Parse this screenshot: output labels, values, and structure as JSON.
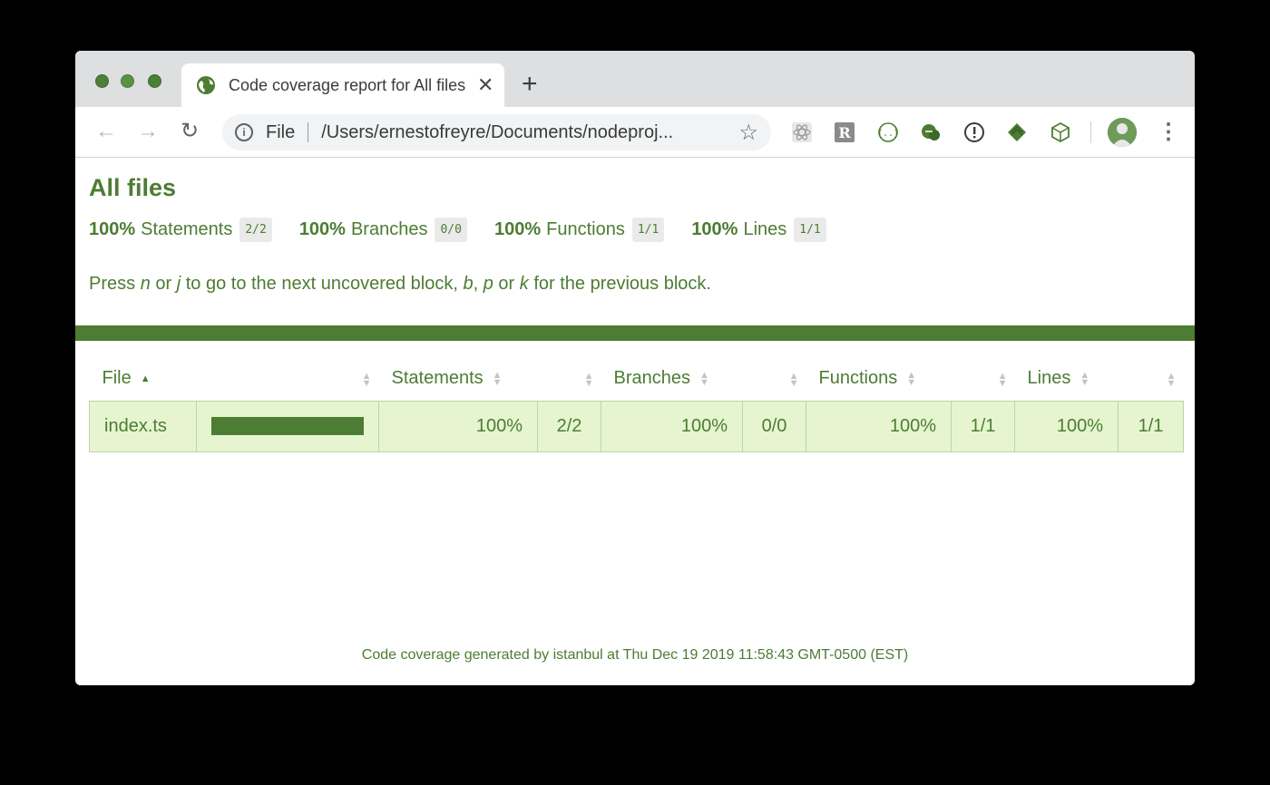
{
  "browser": {
    "tab_title": "Code coverage report for All files",
    "new_tab": "+",
    "omnibox_scheme": "File",
    "omnibox_url": "/Users/ernestofreyre/Documents/nodeproj..."
  },
  "page": {
    "title": "All files",
    "summary": [
      {
        "pct": "100%",
        "label": "Statements",
        "fraction": "2/2"
      },
      {
        "pct": "100%",
        "label": "Branches",
        "fraction": "0/0"
      },
      {
        "pct": "100%",
        "label": "Functions",
        "fraction": "1/1"
      },
      {
        "pct": "100%",
        "label": "Lines",
        "fraction": "1/1"
      }
    ],
    "hint": {
      "press": "Press ",
      "k1": "n",
      "or1": " or ",
      "k2": "j",
      "mid": " to go to the next uncovered block, ",
      "k3": "b",
      "comma": ", ",
      "k4": "p",
      "or2": " or ",
      "k5": "k",
      "end": " for the previous block."
    },
    "table": {
      "headers": [
        "File",
        "Statements",
        "Branches",
        "Functions",
        "Lines"
      ],
      "rows": [
        {
          "file": "index.ts",
          "coverage_fraction": 1.0,
          "statements_pct": "100%",
          "statements": "2/2",
          "branches_pct": "100%",
          "branches": "0/0",
          "functions_pct": "100%",
          "functions": "1/1",
          "lines_pct": "100%",
          "lines": "1/1"
        }
      ]
    },
    "footer": "Code coverage generated by istanbul at Thu Dec 19 2019 11:58:43 GMT-0500 (EST)"
  },
  "colors": {
    "accent_green": "#4d7c33",
    "row_bg": "#e6f5d0"
  }
}
